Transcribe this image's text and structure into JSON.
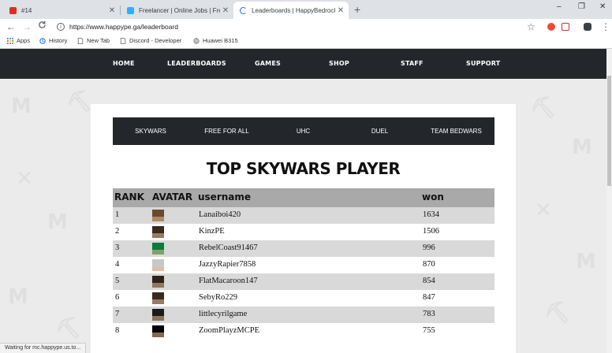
{
  "browser": {
    "tabs": [
      {
        "label": "#14",
        "favicon_color": "#d93025",
        "active": false
      },
      {
        "label": "Freelancer | Online Jobs | Freelan",
        "favicon_color": "#29b2fe",
        "active": false
      },
      {
        "label": "Leaderboards | HappyBedrock",
        "favicon_color": "#1a73e8",
        "active": true
      }
    ],
    "new_tab_glyph": "+",
    "window_controls": [
      "–",
      "❐",
      "✕"
    ],
    "back_glyph": "←",
    "forward_glyph": "→",
    "reload_glyph": "C",
    "url": "https://www.happype.ga/leaderboard",
    "star_glyph": "☆",
    "menu_glyph": "⋮",
    "bookmarks": [
      {
        "label": "Apps",
        "icon": "apps-grid-icon"
      },
      {
        "label": "History",
        "icon": "history-icon"
      },
      {
        "label": "New Tab",
        "icon": "page-icon"
      },
      {
        "label": "Discord - Developer",
        "icon": "page-icon"
      },
      {
        "label": "Huawei B315",
        "icon": "globe-icon"
      }
    ],
    "status_text": "Waiting for mc.happype.us.to..."
  },
  "site": {
    "nav": [
      "HOME",
      "LEADERBOARDS",
      "GAMES",
      "SHOP",
      "STAFF",
      "SUPPORT"
    ],
    "modes": [
      "SKYWARS",
      "FREE FOR ALL",
      "UHC",
      "DUEL",
      "TEAM BEDWARS"
    ],
    "leaderboard_title": "TOP SKYWARS PLAYER",
    "columns": {
      "rank": "RANK",
      "avatar": "AVATAR",
      "username": "username",
      "won": "won"
    },
    "rows": [
      {
        "rank": "1",
        "username": "Lanaiboi420",
        "won": "1634",
        "avatar_color": "#6b4a2b"
      },
      {
        "rank": "2",
        "username": "KinzPE",
        "won": "1506",
        "avatar_color": "#3b2a1c"
      },
      {
        "rank": "3",
        "username": "RebelCoast91467",
        "won": "996",
        "avatar_color": "#0e7a3c"
      },
      {
        "rank": "4",
        "username": "JazzyRapier7858",
        "won": "870",
        "avatar_color": "#c8c8c8"
      },
      {
        "rank": "5",
        "username": "FlatMacaroon147",
        "won": "854",
        "avatar_color": "#2e2219"
      },
      {
        "rank": "6",
        "username": "SebyRo229",
        "won": "847",
        "avatar_color": "#3a2b20"
      },
      {
        "rank": "7",
        "username": "littlecyrilgame",
        "won": "783",
        "avatar_color": "#1a1a1a"
      },
      {
        "rank": "8",
        "username": "ZoomPlayzMCPE",
        "won": "755",
        "avatar_color": "#050505"
      }
    ]
  }
}
